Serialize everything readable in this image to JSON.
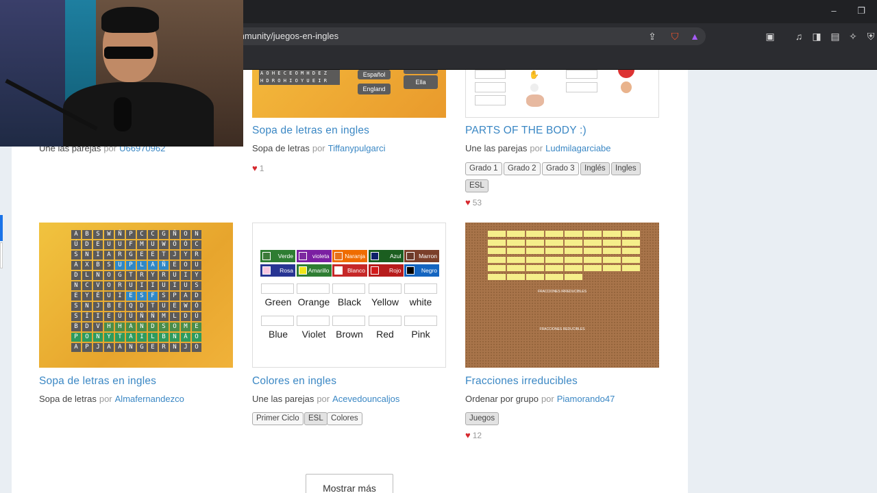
{
  "browser": {
    "url": "mmunity/juegos-en-ingles",
    "controls": {
      "minimize": "–",
      "restore": "❐"
    }
  },
  "cards_row1": [
    {
      "type": "Une las parejas",
      "author": "U66970962"
    },
    {
      "title": "Sopa de letras en ingles",
      "type": "Sopa de letras",
      "author": "Tiffanypulgarci",
      "likes": "1",
      "thumb_words": [
        "Español",
        "England",
        "Ella"
      ]
    },
    {
      "title": "PARTS OF THE BODY :)",
      "type": "Une las parejas",
      "author": "Ludmilagarciabe",
      "likes": "53",
      "tags": [
        "Grado 1",
        "Grado 2",
        "Grado 3",
        "Inglés",
        "Ingles",
        "ESL"
      ]
    }
  ],
  "cards_row2": [
    {
      "title": "Sopa de letras en ingles",
      "type": "Sopa de letras",
      "author": "Almafernandezco",
      "grid": [
        "ABSWÑPCCGÑON",
        "ÚDEUUFMUWÓÓC",
        "SNIARGEETJYR",
        "AXBSUPLAÑEOU",
        "DLNOGTRYRUIY",
        "NCVORUIIUIUS",
        "EYÉUIESFSPAD",
        "SNJBEQDTUEWÓ",
        "SÍIEÚÜÑÑMLDÚ",
        "BDVHHANDSOME",
        "PONYTAILBNÁO",
        "APJAANGERNJO"
      ]
    },
    {
      "title": "Colores en ingles",
      "type": "Une las parejas",
      "author": "Acevedouncaljos",
      "tags": [
        "Primer Ciclo",
        "ESL",
        "Colores"
      ],
      "swatches": [
        {
          "label": "Verde",
          "color": "#2e7d32"
        },
        {
          "label": "violeta",
          "color": "#7b1fa2"
        },
        {
          "label": "Naranja",
          "color": "#ef6c00"
        },
        {
          "label": "Azul",
          "color": "#1b5e20"
        },
        {
          "label": "Marron",
          "color": "#7b3f2a"
        },
        {
          "label": "Rosa",
          "color": "#283593"
        },
        {
          "label": "Amarillo",
          "color": "#2e7d32"
        },
        {
          "label": "Blanco",
          "color": "#c62828"
        },
        {
          "label": "Rojo",
          "color": "#b71c1c"
        },
        {
          "label": "Negro",
          "color": "#1565c0"
        }
      ],
      "words_row1": [
        "Green",
        "Orange",
        "Black",
        "Yellow",
        "white"
      ],
      "words_row2": [
        "Blue",
        "Violet",
        "Brown",
        "Red",
        "Pink"
      ]
    },
    {
      "title": "Fracciones irreducibles",
      "type": "Ordenar por grupo",
      "author": "Piamorando47",
      "likes": "12",
      "tags": [
        "Juegos"
      ],
      "thumb_labels": [
        "FRACCIONES IRREDUCIBLES",
        "FRACCIONES REDUCIBLES"
      ]
    }
  ],
  "common": {
    "por": "por"
  },
  "more_button": "Mostrar más",
  "colors": {
    "accent": "#3a87c4",
    "heart": "#d6282e"
  }
}
